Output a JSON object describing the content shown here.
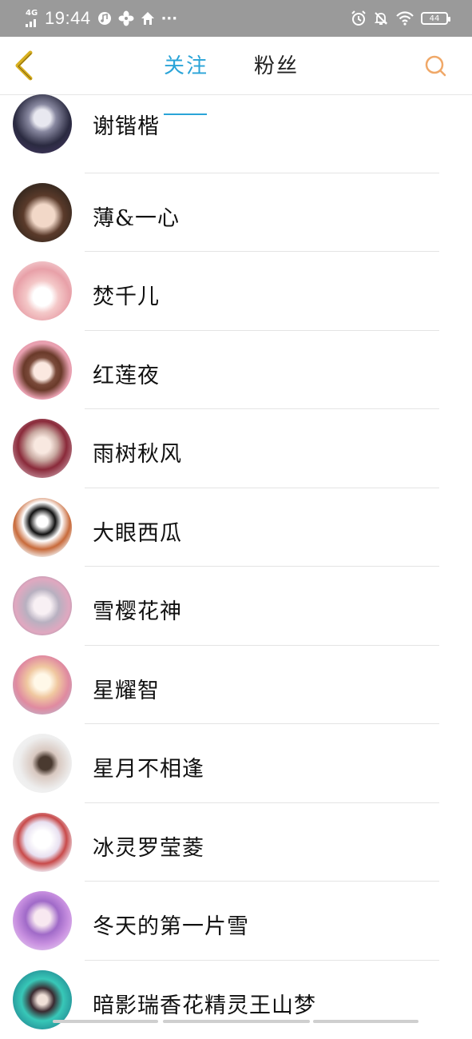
{
  "status_bar": {
    "network": "4G",
    "time": "19:44",
    "more": "···",
    "battery": "44",
    "icons": [
      "signal-icon",
      "music-icon",
      "fan-icon",
      "home-icon",
      "alarm-icon",
      "mute-icon",
      "wifi-icon",
      "battery-icon"
    ]
  },
  "header": {
    "back_icon": "chevron-left-icon",
    "search_icon": "search-icon",
    "tabs": [
      {
        "label": "关注",
        "active": true
      },
      {
        "label": "粉丝",
        "active": false
      }
    ],
    "colors": {
      "active_tab": "#2aa4d8",
      "back_icon": "#d8b020",
      "search_icon": "#f0a868"
    }
  },
  "list": {
    "items": [
      {
        "name": "谢锴楷"
      },
      {
        "name": "薄&一心"
      },
      {
        "name": "焚千儿"
      },
      {
        "name": "红莲夜"
      },
      {
        "name": "雨树秋风"
      },
      {
        "name": "大眼西瓜"
      },
      {
        "name": "雪樱花神"
      },
      {
        "name": "星耀智"
      },
      {
        "name": "星月不相逢"
      },
      {
        "name": "冰灵罗莹菱"
      },
      {
        "name": "冬天的第一片雪"
      },
      {
        "name": "暗影瑞香花精灵王山梦"
      }
    ]
  }
}
